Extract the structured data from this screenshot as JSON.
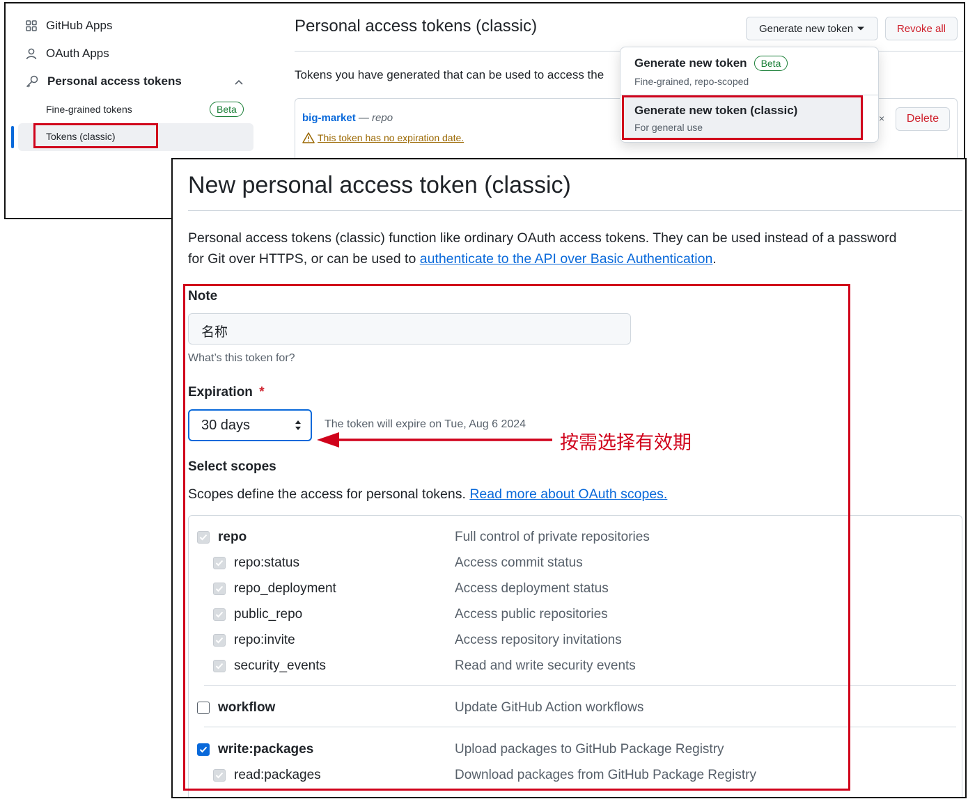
{
  "sidebar": {
    "github_apps": "GitHub Apps",
    "oauth_apps": "OAuth Apps",
    "personal_access_tokens": "Personal access tokens",
    "fine_grained": "Fine-grained tokens",
    "fine_grained_badge": "Beta",
    "tokens_classic": "Tokens (classic)"
  },
  "header": {
    "title": "Personal access tokens (classic)",
    "generate_button": "Generate new token",
    "revoke_button": "Revoke all",
    "intro_text": "Tokens you have generated that can be used to access the"
  },
  "token_item": {
    "name": "big-market",
    "separator": " — ",
    "scope": "repo",
    "warning": "This token has no expiration date.",
    "delete_button": "Delete"
  },
  "dropdown": {
    "option1_title": "Generate new token",
    "option1_badge": "Beta",
    "option1_sub": "Fine-grained, repo-scoped",
    "option2_title": "Generate new token (classic)",
    "option2_sub": "For general use"
  },
  "form": {
    "title": "New personal access token (classic)",
    "desc_line1": "Personal access tokens (classic) function like ordinary OAuth access tokens. They can be used instead of a password",
    "desc_line2_pre": "for Git over HTTPS, or can be used to ",
    "desc_link": "authenticate to the API over Basic Authentication",
    "desc_line2_post": ".",
    "note_label": "Note",
    "note_value": "名称",
    "note_help": "What’s this token for?",
    "expiration_label": "Expiration",
    "required_mark": "*",
    "expiration_value": "30 days",
    "expiration_note": "The token will expire on Tue, Aug 6 2024",
    "annotation": "按需选择有效期",
    "scopes_label": "Select scopes",
    "scopes_desc": "Scopes define the access for personal tokens. ",
    "scopes_link": "Read more about OAuth scopes."
  },
  "scopes": [
    {
      "name": "repo",
      "desc": "Full control of private repositories",
      "state": "disabled",
      "parent": true
    },
    {
      "name": "repo:status",
      "desc": "Access commit status",
      "state": "disabled",
      "parent": false
    },
    {
      "name": "repo_deployment",
      "desc": "Access deployment status",
      "state": "disabled",
      "parent": false
    },
    {
      "name": "public_repo",
      "desc": "Access public repositories",
      "state": "disabled",
      "parent": false
    },
    {
      "name": "repo:invite",
      "desc": "Access repository invitations",
      "state": "disabled",
      "parent": false
    },
    {
      "name": "security_events",
      "desc": "Read and write security events",
      "state": "disabled",
      "parent": false
    },
    {
      "name": "workflow",
      "desc": "Update GitHub Action workflows",
      "state": "unchecked",
      "parent": true
    },
    {
      "name": "write:packages",
      "desc": "Upload packages to GitHub Package Registry",
      "state": "checked",
      "parent": true
    },
    {
      "name": "read:packages",
      "desc": "Download packages from GitHub Package Registry",
      "state": "disabled",
      "parent": false
    }
  ],
  "colors": {
    "annotation_red": "#d0021b",
    "link_blue": "#0969da",
    "beta_green": "#1a7f37",
    "danger_red": "#cf222e"
  }
}
